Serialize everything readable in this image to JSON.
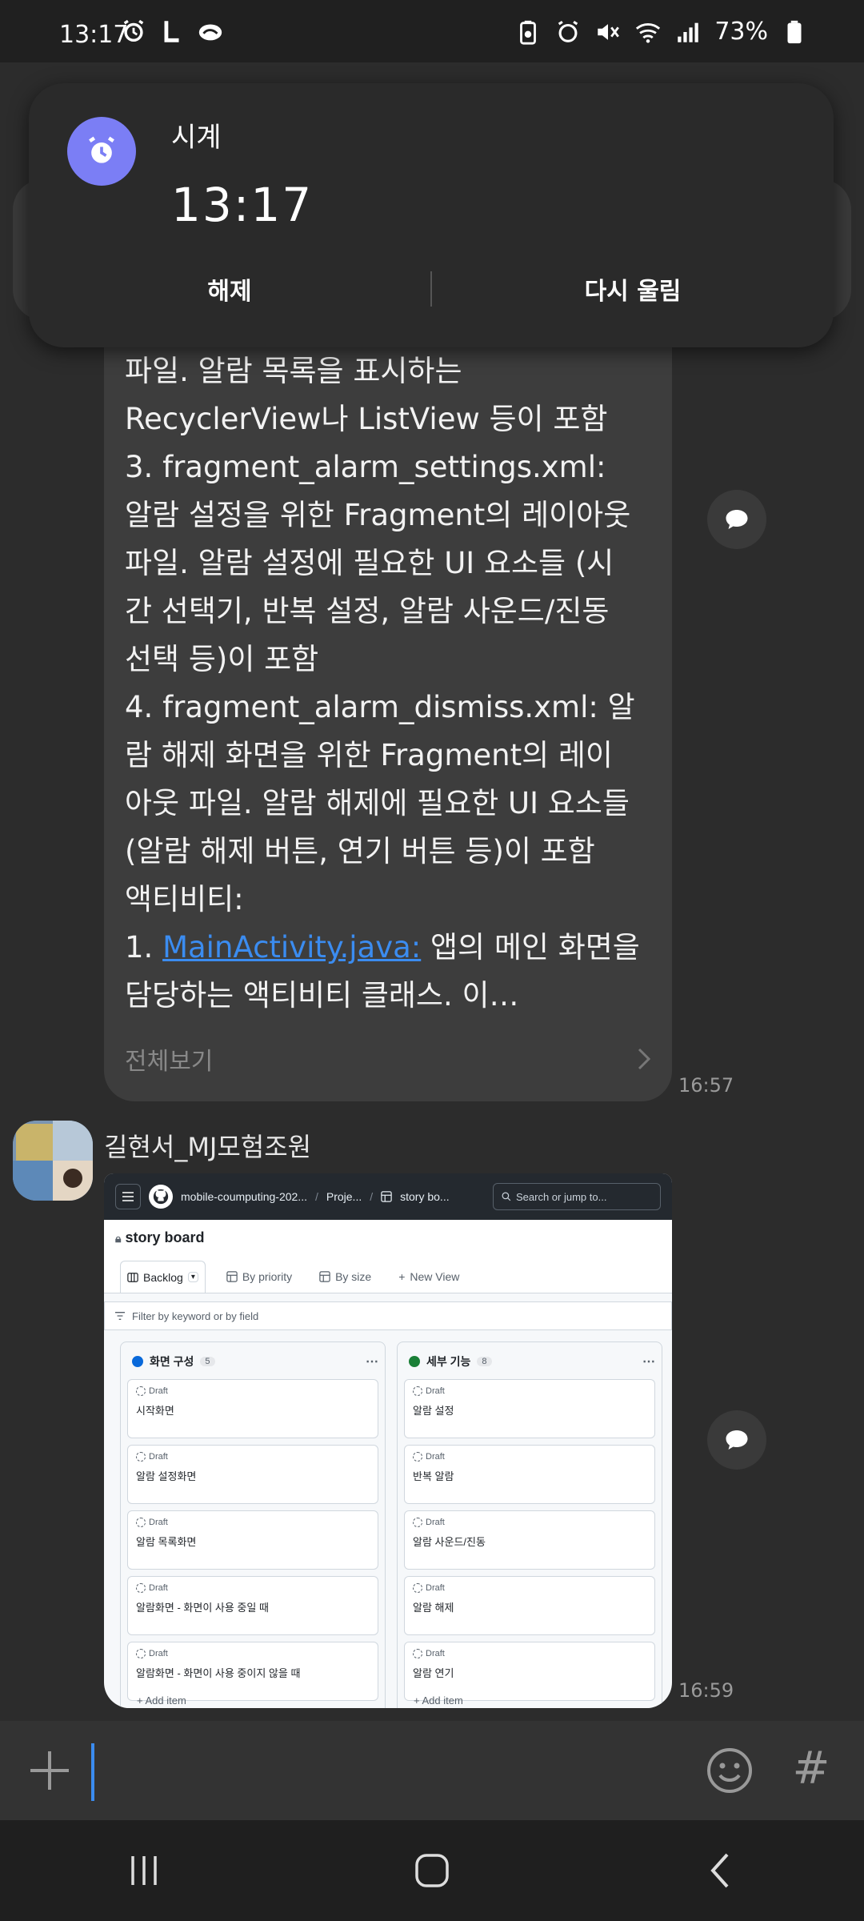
{
  "status_bar": {
    "time": "13:17",
    "battery": "73%"
  },
  "notification": {
    "app_name": "시계",
    "alarm_time": "13:17",
    "dismiss_label": "해제",
    "snooze_label": "다시 울림"
  },
  "message": {
    "lines": [
      "파일. 알람 목록을 표시하는",
      "RecyclerView나 ListView 등이 포함",
      "3. fragment_alarm_settings.xml:",
      "알람 설정을 위한 Fragment의 레이아웃",
      "파일. 알람 설정에 필요한 UI 요소들 (시",
      "간 선택기, 반복 설정, 알람 사운드/진동",
      "선택 등)이 포함",
      "4. fragment_alarm_dismiss.xml: 알",
      "람 해제 화면을 위한 Fragment의 레이",
      "아웃 파일. 알람 해제에 필요한 UI 요소들",
      "(알람 해제 버튼, 연기 버튼 등)이 포함",
      "액티비티:"
    ],
    "link_prefix": "1. ",
    "link_text": "MainActivity.java:",
    "link_suffix": " 앱의 메인 화면을",
    "last_line": "담당하는 액티비티 클래스. 이…",
    "view_more": "전체보기",
    "time": "16:57"
  },
  "sender": {
    "name": "길현서_MJ모험조원"
  },
  "image_message": {
    "time": "16:59",
    "github": {
      "crumbs": [
        "mobile-coumputing-202...",
        "Proje...",
        "story bo..."
      ],
      "search_placeholder": "Search or jump to...",
      "project_title": "story board",
      "tabs": [
        "Backlog",
        "By priority",
        "By size",
        "New View"
      ],
      "filter_placeholder": "Filter by keyword or by field",
      "columns": [
        {
          "title": "화면 구성",
          "count": "5",
          "color": "#0969da",
          "cards": [
            {
              "status": "Draft",
              "title": "시작화면"
            },
            {
              "status": "Draft",
              "title": "알람 설정화면"
            },
            {
              "status": "Draft",
              "title": "알람 목록화면"
            },
            {
              "status": "Draft",
              "title": "알람화면 - 화면이 사용 중일 때"
            },
            {
              "status": "Draft",
              "title": "알람화면 - 화면이 사용 중이지 않을 때"
            }
          ]
        },
        {
          "title": "세부 기능",
          "count": "8",
          "color": "#1a7f37",
          "cards": [
            {
              "status": "Draft",
              "title": "알람 설정"
            },
            {
              "status": "Draft",
              "title": "반복 알람"
            },
            {
              "status": "Draft",
              "title": "알람 사운드/진동"
            },
            {
              "status": "Draft",
              "title": "알람 해제"
            },
            {
              "status": "Draft",
              "title": "알람 연기"
            }
          ]
        }
      ],
      "add_item": "+ Add item"
    }
  },
  "input": {
    "placeholder": "",
    "hash": "#"
  },
  "colors": {
    "accent": "#3b8cf0",
    "notif_icon_bg": "#7b7ef5"
  }
}
